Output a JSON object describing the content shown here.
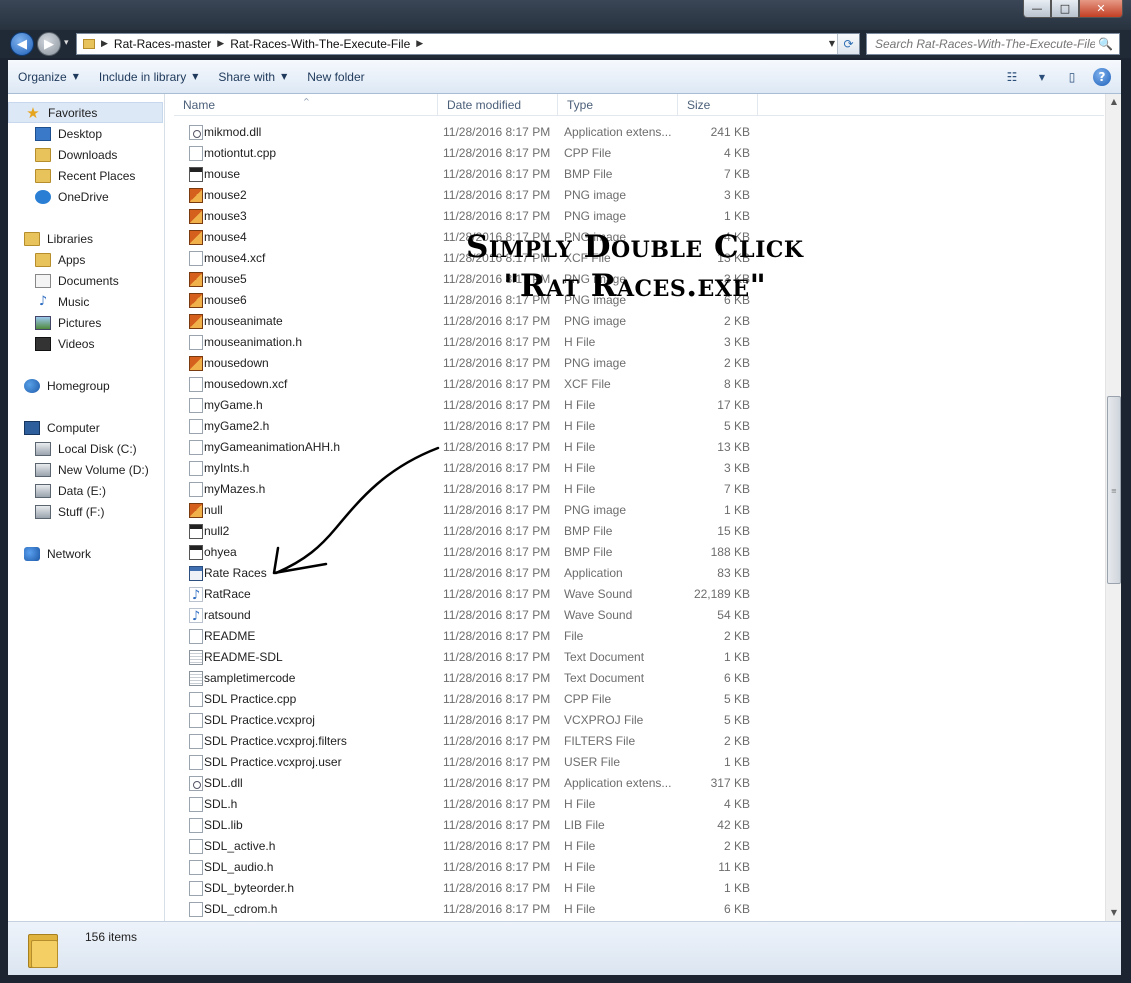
{
  "window": {
    "minimize_glyph": "—",
    "maximize_glyph": "□",
    "close_glyph": "✕"
  },
  "navigation": {
    "back_glyph": "◀",
    "forward_glyph": "▶",
    "history_glyph": "▾"
  },
  "address": {
    "crumbs": [
      "Rat-Races-master",
      "Rat-Races-With-The-Execute-File"
    ],
    "separator_glyph": "▶",
    "dropdown_glyph": "▼",
    "refresh_glyph": "⟳"
  },
  "search": {
    "placeholder": "Search Rat-Races-With-The-Execute-File",
    "icon_glyph": "🔍"
  },
  "toolbar": {
    "organize": "Organize",
    "include_in_library": "Include in library",
    "share_with": "Share with",
    "new_folder": "New folder",
    "caret": "▼",
    "views_glyph": "☷",
    "views_caret": "▼",
    "preview_glyph": "▯",
    "help_glyph": "?"
  },
  "navpane": {
    "favorites": "Favorites",
    "desktop": "Desktop",
    "downloads": "Downloads",
    "recent_places": "Recent Places",
    "onedrive": "OneDrive",
    "libraries": "Libraries",
    "apps": "Apps",
    "documents": "Documents",
    "music": "Music",
    "pictures": "Pictures",
    "videos": "Videos",
    "homegroup": "Homegroup",
    "computer": "Computer",
    "local_disk": "Local Disk (C:)",
    "new_volume": "New Volume (D:)",
    "data": "Data (E:)",
    "stuff": "Stuff (F:)",
    "network": "Network",
    "star_glyph": "★",
    "note_glyph": "♪"
  },
  "columns": {
    "name": "Name",
    "date_modified": "Date modified",
    "type": "Type",
    "size": "Size",
    "sort_glyph": "^"
  },
  "files": [
    {
      "name": "mikmod.dll",
      "date": "11/28/2016 8:17 PM",
      "type": "Application extens...",
      "size": "241 KB",
      "icon": "dll"
    },
    {
      "name": "motiontut.cpp",
      "date": "11/28/2016 8:17 PM",
      "type": "CPP File",
      "size": "4 KB",
      "icon": "generic"
    },
    {
      "name": "mouse",
      "date": "11/28/2016 8:17 PM",
      "type": "BMP File",
      "size": "7 KB",
      "icon": "bmp"
    },
    {
      "name": "mouse2",
      "date": "11/28/2016 8:17 PM",
      "type": "PNG image",
      "size": "3 KB",
      "icon": "png"
    },
    {
      "name": "mouse3",
      "date": "11/28/2016 8:17 PM",
      "type": "PNG image",
      "size": "1 KB",
      "icon": "png"
    },
    {
      "name": "mouse4",
      "date": "11/28/2016 8:17 PM",
      "type": "PNG image",
      "size": "4 KB",
      "icon": "png"
    },
    {
      "name": "mouse4.xcf",
      "date": "11/28/2016 8:17 PM",
      "type": "XCF File",
      "size": "13 KB",
      "icon": "generic"
    },
    {
      "name": "mouse5",
      "date": "11/28/2016 8:17 PM",
      "type": "PNG image",
      "size": "3 KB",
      "icon": "png"
    },
    {
      "name": "mouse6",
      "date": "11/28/2016 8:17 PM",
      "type": "PNG image",
      "size": "6 KB",
      "icon": "png"
    },
    {
      "name": "mouseanimate",
      "date": "11/28/2016 8:17 PM",
      "type": "PNG image",
      "size": "2 KB",
      "icon": "png"
    },
    {
      "name": "mouseanimation.h",
      "date": "11/28/2016 8:17 PM",
      "type": "H File",
      "size": "3 KB",
      "icon": "generic"
    },
    {
      "name": "mousedown",
      "date": "11/28/2016 8:17 PM",
      "type": "PNG image",
      "size": "2 KB",
      "icon": "png"
    },
    {
      "name": "mousedown.xcf",
      "date": "11/28/2016 8:17 PM",
      "type": "XCF File",
      "size": "8 KB",
      "icon": "generic"
    },
    {
      "name": "myGame.h",
      "date": "11/28/2016 8:17 PM",
      "type": "H File",
      "size": "17 KB",
      "icon": "generic"
    },
    {
      "name": "myGame2.h",
      "date": "11/28/2016 8:17 PM",
      "type": "H File",
      "size": "5 KB",
      "icon": "generic"
    },
    {
      "name": "myGameanimationAHH.h",
      "date": "11/28/2016 8:17 PM",
      "type": "H File",
      "size": "13 KB",
      "icon": "generic"
    },
    {
      "name": "myInts.h",
      "date": "11/28/2016 8:17 PM",
      "type": "H File",
      "size": "3 KB",
      "icon": "generic"
    },
    {
      "name": "myMazes.h",
      "date": "11/28/2016 8:17 PM",
      "type": "H File",
      "size": "7 KB",
      "icon": "generic"
    },
    {
      "name": "null",
      "date": "11/28/2016 8:17 PM",
      "type": "PNG image",
      "size": "1 KB",
      "icon": "png"
    },
    {
      "name": "null2",
      "date": "11/28/2016 8:17 PM",
      "type": "BMP File",
      "size": "15 KB",
      "icon": "bmp"
    },
    {
      "name": "ohyea",
      "date": "11/28/2016 8:17 PM",
      "type": "BMP File",
      "size": "188 KB",
      "icon": "bmp"
    },
    {
      "name": "Rate Races",
      "date": "11/28/2016 8:17 PM",
      "type": "Application",
      "size": "83 KB",
      "icon": "app"
    },
    {
      "name": "RatRace",
      "date": "11/28/2016 8:17 PM",
      "type": "Wave Sound",
      "size": "22,189 KB",
      "icon": "wav"
    },
    {
      "name": "ratsound",
      "date": "11/28/2016 8:17 PM",
      "type": "Wave Sound",
      "size": "54 KB",
      "icon": "wav"
    },
    {
      "name": "README",
      "date": "11/28/2016 8:17 PM",
      "type": "File",
      "size": "2 KB",
      "icon": "generic"
    },
    {
      "name": "README-SDL",
      "date": "11/28/2016 8:17 PM",
      "type": "Text Document",
      "size": "1 KB",
      "icon": "text"
    },
    {
      "name": "sampletimercode",
      "date": "11/28/2016 8:17 PM",
      "type": "Text Document",
      "size": "6 KB",
      "icon": "text"
    },
    {
      "name": "SDL Practice.cpp",
      "date": "11/28/2016 8:17 PM",
      "type": "CPP File",
      "size": "5 KB",
      "icon": "generic"
    },
    {
      "name": "SDL Practice.vcxproj",
      "date": "11/28/2016 8:17 PM",
      "type": "VCXPROJ File",
      "size": "5 KB",
      "icon": "generic"
    },
    {
      "name": "SDL Practice.vcxproj.filters",
      "date": "11/28/2016 8:17 PM",
      "type": "FILTERS File",
      "size": "2 KB",
      "icon": "generic"
    },
    {
      "name": "SDL Practice.vcxproj.user",
      "date": "11/28/2016 8:17 PM",
      "type": "USER File",
      "size": "1 KB",
      "icon": "generic"
    },
    {
      "name": "SDL.dll",
      "date": "11/28/2016 8:17 PM",
      "type": "Application extens...",
      "size": "317 KB",
      "icon": "dll"
    },
    {
      "name": "SDL.h",
      "date": "11/28/2016 8:17 PM",
      "type": "H File",
      "size": "4 KB",
      "icon": "generic"
    },
    {
      "name": "SDL.lib",
      "date": "11/28/2016 8:17 PM",
      "type": "LIB File",
      "size": "42 KB",
      "icon": "generic"
    },
    {
      "name": "SDL_active.h",
      "date": "11/28/2016 8:17 PM",
      "type": "H File",
      "size": "2 KB",
      "icon": "generic"
    },
    {
      "name": "SDL_audio.h",
      "date": "11/28/2016 8:17 PM",
      "type": "H File",
      "size": "11 KB",
      "icon": "generic"
    },
    {
      "name": "SDL_byteorder.h",
      "date": "11/28/2016 8:17 PM",
      "type": "H File",
      "size": "1 KB",
      "icon": "generic"
    },
    {
      "name": "SDL_cdrom.h",
      "date": "11/28/2016 8:17 PM",
      "type": "H File",
      "size": "6 KB",
      "icon": "generic"
    }
  ],
  "scrollbar": {
    "up_glyph": "▲",
    "down_glyph": "▼",
    "grip_glyph": "≡"
  },
  "status": {
    "item_count": "156 items"
  },
  "annotation": {
    "line1": "Simply Double Click",
    "line2": "\"Rat Races.exe\""
  }
}
